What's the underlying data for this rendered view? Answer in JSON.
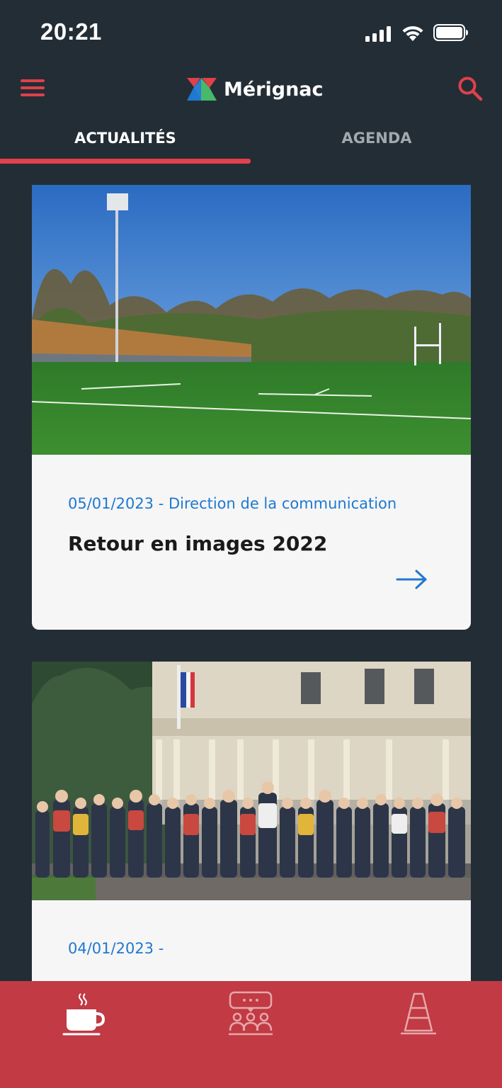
{
  "status_bar": {
    "time": "20:21",
    "icons": [
      "cellular-signal-icon",
      "wifi-icon",
      "battery-icon"
    ]
  },
  "header": {
    "brand_name": "Mérignac",
    "icons": [
      "menu-icon",
      "merignac-logo",
      "search-icon"
    ],
    "accent_color": "#e0414b"
  },
  "tabs": [
    {
      "label": "ACTUALITÉS",
      "active": true
    },
    {
      "label": "AGENDA",
      "active": false
    }
  ],
  "articles": [
    {
      "meta": "05/01/2023 - Direction de la communication",
      "title": "Retour en images 2022",
      "image": "sports-field-photo",
      "icon": "arrow-right-icon"
    },
    {
      "meta": "04/01/2023 -",
      "title": "",
      "image": "group-photo-town-hall"
    }
  ],
  "bottom_nav": {
    "background": "#c13a44",
    "items": [
      {
        "icon": "coffee-cup-icon",
        "active": true
      },
      {
        "icon": "community-meeting-icon",
        "active": false
      },
      {
        "icon": "traffic-cone-icon",
        "active": false
      }
    ]
  },
  "colors": {
    "background": "#232d35",
    "link_blue": "#1f78d1"
  }
}
